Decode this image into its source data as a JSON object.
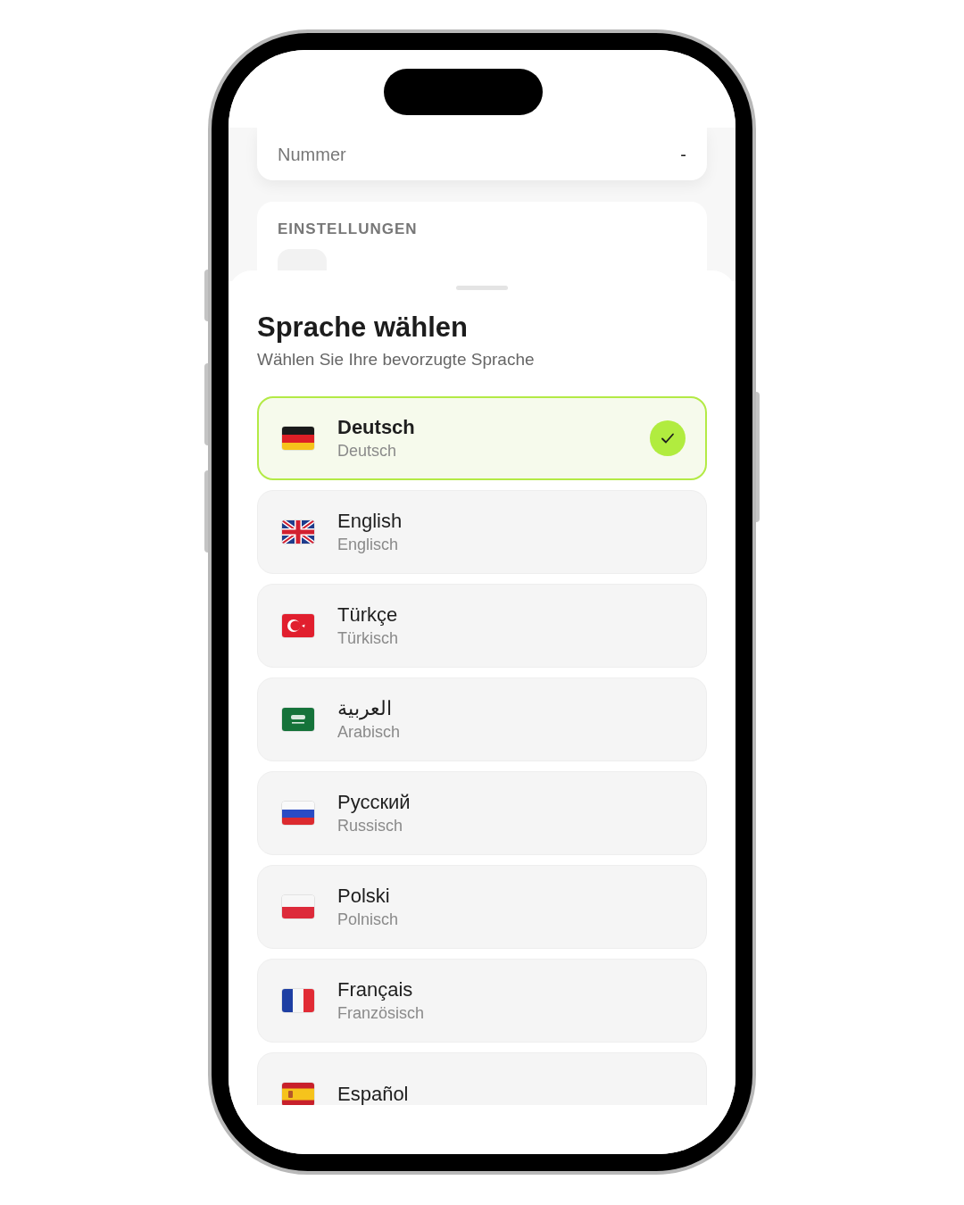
{
  "background": {
    "number_row": {
      "label": "Nummer",
      "value": "-"
    },
    "settings": {
      "heading": "EINSTELLUNGEN"
    }
  },
  "sheet": {
    "title": "Sprache wählen",
    "subtitle": "Wählen Sie Ihre bevorzugte Sprache",
    "languages": [
      {
        "kind": "de",
        "name": "Deutsch",
        "translation": "Deutsch",
        "selected": true
      },
      {
        "kind": "gb",
        "name": "English",
        "translation": "Englisch",
        "selected": false
      },
      {
        "kind": "tr",
        "name": "Türkçe",
        "translation": "Türkisch",
        "selected": false
      },
      {
        "kind": "sa",
        "name": "العربية",
        "translation": "Arabisch",
        "selected": false
      },
      {
        "kind": "ru",
        "name": "Русский",
        "translation": "Russisch",
        "selected": false
      },
      {
        "kind": "pl",
        "name": "Polski",
        "translation": "Polnisch",
        "selected": false
      },
      {
        "kind": "fr",
        "name": "Français",
        "translation": "Französisch",
        "selected": false
      },
      {
        "kind": "es",
        "name": "Español",
        "selected": false
      }
    ]
  }
}
